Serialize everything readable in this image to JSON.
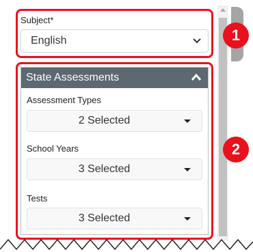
{
  "subject": {
    "label": "Subject*",
    "value": "English"
  },
  "state_assessments": {
    "title": "State Assessments",
    "fields": [
      {
        "label": "Assessment Types",
        "value": "2 Selected"
      },
      {
        "label": "School Years",
        "value": "3 Selected"
      },
      {
        "label": "Tests",
        "value": "3 Selected"
      }
    ]
  },
  "callouts": [
    "1",
    "2"
  ],
  "colors": {
    "highlight": "#e8111d",
    "header_bg": "#5d6870"
  },
  "icons": {
    "subject_dropdown": "chevron-down-icon",
    "collapse": "chevron-up-icon",
    "field_dropdown": "caret-down-icon"
  }
}
